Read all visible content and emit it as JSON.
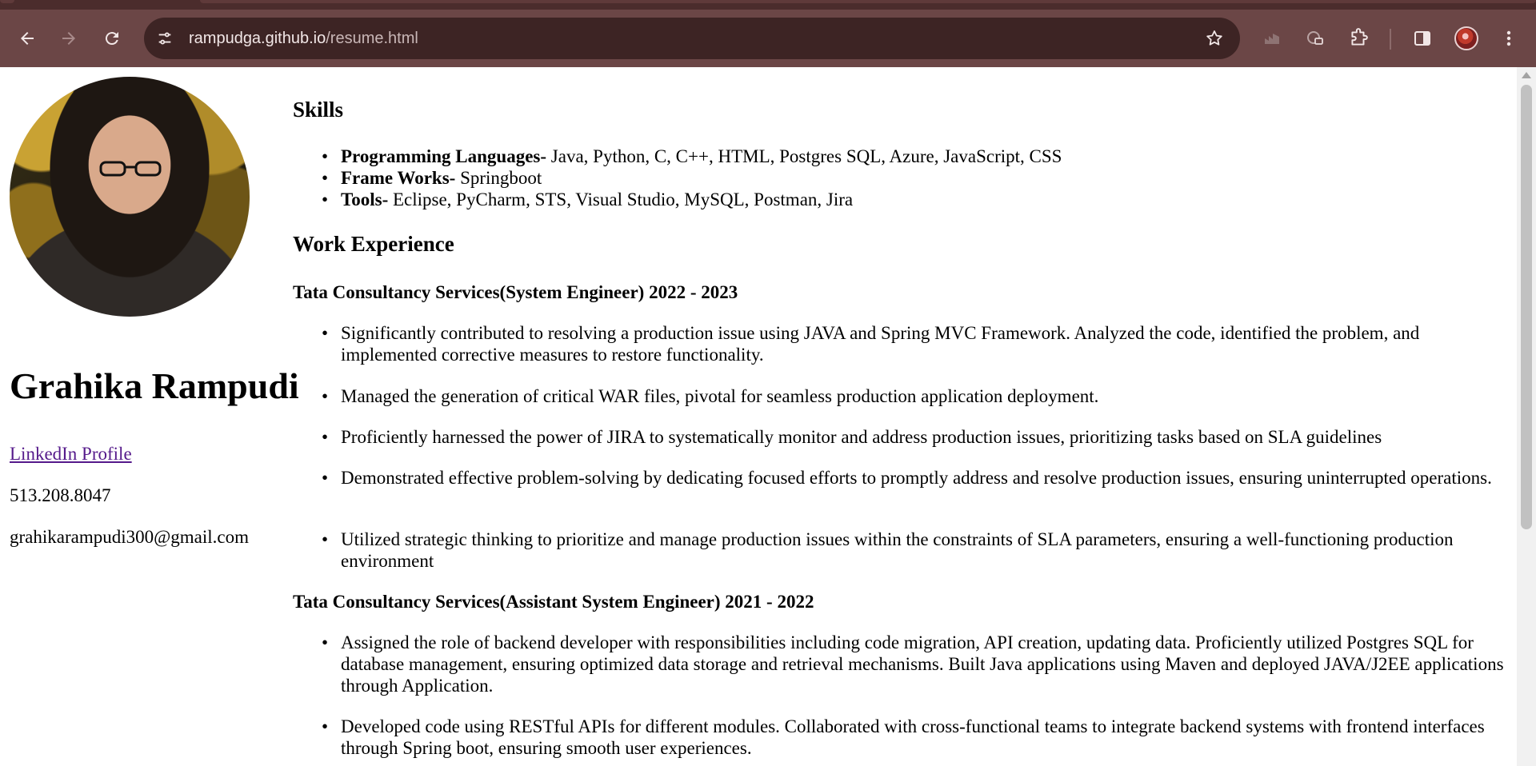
{
  "browser": {
    "url_host": "rampudga.github.io",
    "url_path": "/resume.html",
    "colors": {
      "toolbar": "#6b4646",
      "omnibox": "#3d2424",
      "tabstrip": "#4b2c2c"
    },
    "icons": [
      "back-arrow-icon",
      "forward-arrow-icon",
      "reload-icon",
      "site-info-icon",
      "bookmark-star-icon",
      "performance-icon",
      "media-icon",
      "extensions-puzzle-icon",
      "side-panel-icon",
      "profile-avatar",
      "kebab-menu-icon"
    ]
  },
  "profile": {
    "name": "Grahika Rampudi",
    "linkedin_label": "LinkedIn Profile",
    "phone": "513.208.8047",
    "email": "grahikarampudi300@gmail.com",
    "link_color": "#551a8b"
  },
  "skills": {
    "heading": "Skills",
    "items": [
      {
        "label": "Programming Languages-",
        "value": " Java, Python, C, C++, HTML, Postgres SQL, Azure, JavaScript, CSS"
      },
      {
        "label": "Frame Works-",
        "value": " Springboot"
      },
      {
        "label": "Tools-",
        "value": " Eclipse, PyCharm, STS, Visual Studio, MySQL, Postman, Jira"
      }
    ]
  },
  "experience": {
    "heading": "Work Experience",
    "jobs": [
      {
        "title": "Tata Consultancy Services(System Engineer) 2022 - 2023",
        "bullets": [
          "Significantly contributed to resolving a production issue using JAVA and Spring MVC Framework. Analyzed the code, identified the problem, and implemented corrective measures to restore functionality.",
          "Managed the generation of critical WAR files, pivotal for seamless production application deployment.",
          "Proficiently harnessed the power of JIRA to systematically monitor and address production issues, prioritizing tasks based on SLA guidelines",
          "Demonstrated effective problem-solving by dedicating focused efforts to promptly address and resolve production issues, ensuring uninterrupted operations.",
          "Utilized strategic thinking to prioritize and manage production issues within the constraints of SLA parameters, ensuring a well-functioning production environment"
        ]
      },
      {
        "title": "Tata Consultancy Services(Assistant System Engineer) 2021 - 2022",
        "bullets": [
          "Assigned the role of backend developer with responsibilities including code migration, API creation, updating data. Proficiently utilized Postgres SQL for database management, ensuring optimized data storage and retrieval mechanisms. Built Java applications using Maven and deployed JAVA/J2EE applications through Application.",
          "Developed code using RESTful APIs for different modules. Collaborated with cross-functional teams to integrate backend systems with frontend interfaces through Spring boot, ensuring smooth user experiences."
        ]
      }
    ]
  }
}
